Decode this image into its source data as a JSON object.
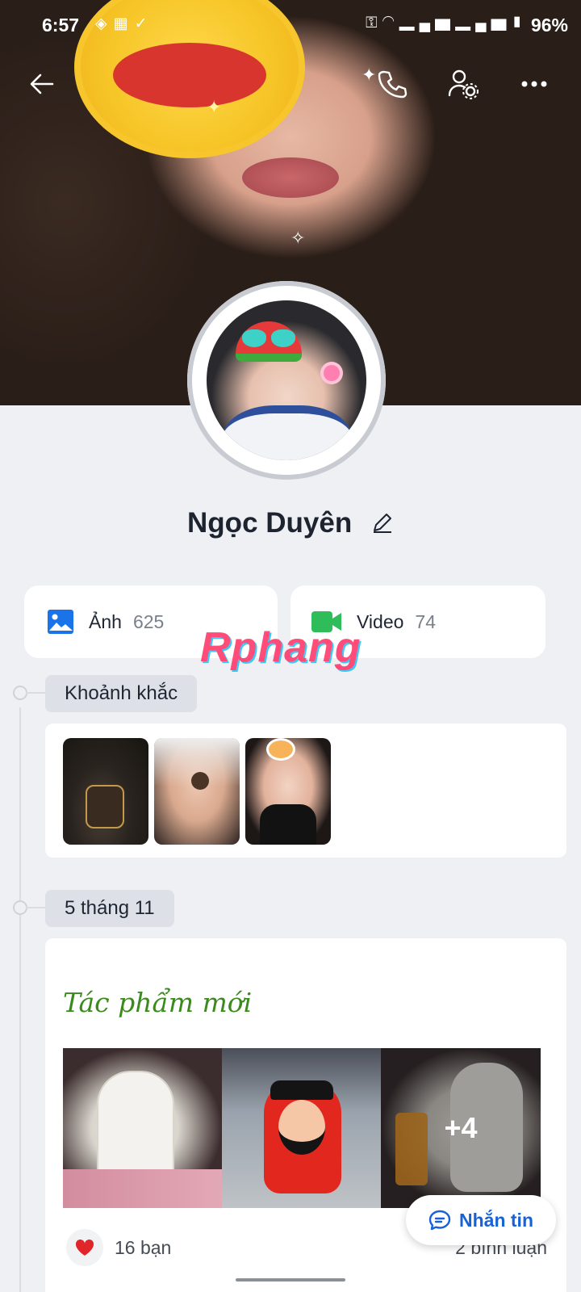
{
  "status_bar": {
    "time": "6:57",
    "left_icons": [
      "shield-icon",
      "momo-icon",
      "v-icon"
    ],
    "right_icons": [
      "key-icon",
      "wifi-icon",
      "signal-icon",
      "signal-icon"
    ],
    "battery": "96%"
  },
  "top_bar": {
    "back_icon": "arrow-left-icon",
    "call_icon": "phone-icon",
    "settings_icon": "user-settings-icon",
    "more_icon": "more-horizontal-icon"
  },
  "profile": {
    "name": "Ngọc Duyên",
    "edit_icon": "pencil-icon"
  },
  "media": {
    "photos": {
      "label": "Ảnh",
      "count": "625",
      "icon": "image-icon",
      "color": "#1a73e8"
    },
    "videos": {
      "label": "Video",
      "count": "74",
      "icon": "video-icon",
      "color": "#2ebd59"
    }
  },
  "watermark": "Rphang",
  "moments": {
    "label": "Khoảnh khắc",
    "items": [
      "moment-1",
      "moment-2",
      "moment-3"
    ]
  },
  "post": {
    "date": "5 tháng 11",
    "title": "Tác phẩm mới",
    "more_count": "+4",
    "reactions": "16 bạn",
    "comments": "2 bình luận"
  },
  "message_button": {
    "label": "Nhắn tin",
    "icon": "chat-icon",
    "color": "#1762d6"
  }
}
